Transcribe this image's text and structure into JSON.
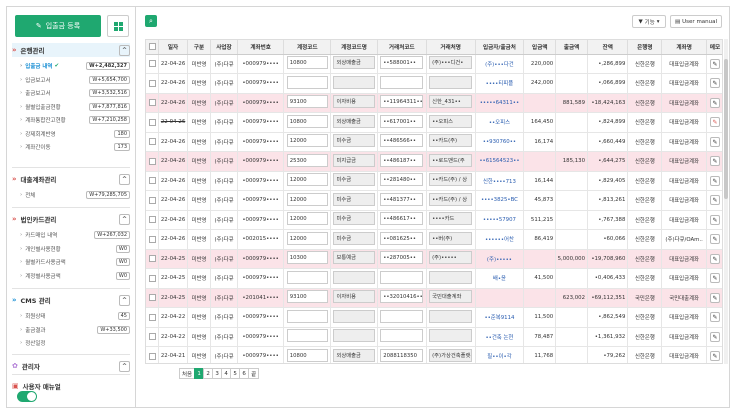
{
  "sidebar": {
    "register_label": "입출금 등록",
    "sections": [
      {
        "title": "은행관리",
        "items": [
          {
            "label": "입출금 내역",
            "badge": "W+2,482,327",
            "current": true
          },
          {
            "label": "입금보고서",
            "badge": "W+5,654,700"
          },
          {
            "label": "출금보고서",
            "badge": "W+3,532,516"
          },
          {
            "label": "월별입출금현황",
            "badge": "W+7,877,816"
          },
          {
            "label": "계좌통합잔고현황",
            "badge": "W+7,210,258"
          },
          {
            "label": "강제회계반영",
            "badge": "180"
          },
          {
            "label": "계좌간이동",
            "badge": "173"
          }
        ]
      },
      {
        "title": "대출계좌관리",
        "items": [
          {
            "label": "전체",
            "badge": "W+79,285,705"
          }
        ]
      },
      {
        "title": "법인카드관리",
        "items": [
          {
            "label": "카드매입 내역",
            "badge": "W+267,032"
          },
          {
            "label": "개인별사용현황",
            "badge": "W0"
          },
          {
            "label": "월별카드사용금액",
            "badge": "W0"
          },
          {
            "label": "계정별사용금액",
            "badge": "W0"
          }
        ]
      },
      {
        "title": "CMS 관리",
        "items": [
          {
            "label": "회원상태",
            "badge": "45"
          },
          {
            "label": "출금결과",
            "badge": "W+33,500"
          },
          {
            "label": "정산일정",
            "badge": ""
          }
        ]
      },
      {
        "title": "관리자",
        "items": []
      },
      {
        "title": "사용자 매뉴얼",
        "items": []
      }
    ]
  },
  "toolbar": {
    "filter_label": "기능",
    "manual_label": "User manual"
  },
  "table": {
    "headers": [
      "일자",
      "구분",
      "사업장",
      "계좌번호",
      "계정코드",
      "계정코드명",
      "거래처코드",
      "거래처명",
      "입금자/출금처",
      "입금액",
      "출금액",
      "잔액",
      "은행명",
      "계좌명",
      "메모"
    ],
    "rows": [
      {
        "date": "22-04-26",
        "gubun": "미반영",
        "biz": "(주)다큐",
        "acct": "•000979••••",
        "code": "10800",
        "codename": "외상매출금",
        "vcode": "••588001••",
        "vname": "(주)•••디건•",
        "payer": "(주)•••다건",
        "in": "220,000",
        "out": "",
        "bal": "•,286,899",
        "bank": "신한은행",
        "acctname": "대표입금계좌",
        "hl": false,
        "strike": false,
        "redEdit": false
      },
      {
        "date": "22-04-26",
        "gubun": "미반영",
        "biz": "(주)다큐",
        "acct": "•000979••••",
        "code": "",
        "codename": "",
        "vcode": "",
        "vname": "",
        "payer": "••••티피플",
        "in": "242,000",
        "out": "",
        "bal": "•,066,899",
        "bank": "신한은행",
        "acctname": "대표입금계좌",
        "hl": false,
        "strike": false,
        "redEdit": false
      },
      {
        "date": "22-04-26",
        "gubun": "미반영",
        "biz": "(주)다큐",
        "acct": "•000979••••",
        "code": "93100",
        "codename": "이자비용",
        "vcode": "••11964311••",
        "vname": "신한_431••",
        "payer": "•••••64311••",
        "in": "",
        "out": "881,589",
        "bal": "•18,424,163",
        "bank": "신한은행",
        "acctname": "대표입금계좌",
        "hl": true,
        "strike": false,
        "redEdit": false
      },
      {
        "date": "22-04-26",
        "gubun": "미반영",
        "biz": "(주)다큐",
        "acct": "•000979••••",
        "code": "10800",
        "codename": "외상매출금",
        "vcode": "••617001••",
        "vname": "••오피스",
        "payer": "••오피스",
        "in": "164,450",
        "out": "",
        "bal": "•,824,899",
        "bank": "신한은행",
        "acctname": "대표입금계좌",
        "hl": false,
        "strike": true,
        "redEdit": true
      },
      {
        "date": "22-04-26",
        "gubun": "미반영",
        "biz": "(주)다큐",
        "acct": "•000979••••",
        "code": "12000",
        "codename": "미수금",
        "vcode": "••486566••",
        "vname": "••카드(주)",
        "payer": "••930760••",
        "in": "16,174",
        "out": "",
        "bal": "•,660,449",
        "bank": "신한은행",
        "acctname": "대표입금계좌",
        "hl": false,
        "strike": false,
        "redEdit": false
      },
      {
        "date": "22-04-26",
        "gubun": "미반영",
        "biz": "(주)다큐",
        "acct": "•000979••••",
        "code": "25300",
        "codename": "미지급금",
        "vcode": "••486187••",
        "vname": "••로드맨드(주",
        "payer": "••61564523••",
        "in": "",
        "out": "185,130",
        "bal": "•,644,275",
        "bank": "신한은행",
        "acctname": "대표입금계좌",
        "hl": true,
        "strike": false,
        "redEdit": false
      },
      {
        "date": "22-04-26",
        "gubun": "미반영",
        "biz": "(주)다큐",
        "acct": "•000979••••",
        "code": "12000",
        "codename": "미수금",
        "vcode": "••281480••",
        "vname": "••카드(주) / 상",
        "payer": "신한••••713",
        "in": "16,144",
        "out": "",
        "bal": "•,829,405",
        "bank": "신한은행",
        "acctname": "대표입금계좌",
        "hl": false,
        "strike": false,
        "redEdit": false
      },
      {
        "date": "22-04-26",
        "gubun": "미반영",
        "biz": "(주)다큐",
        "acct": "•000979••••",
        "code": "12000",
        "codename": "미수금",
        "vcode": "••481377••",
        "vname": "••카드(주) / 상",
        "payer": "••••3825•BC",
        "in": "45,873",
        "out": "",
        "bal": "•,813,261",
        "bank": "신한은행",
        "acctname": "대표입금계좌",
        "hl": false,
        "strike": false,
        "redEdit": false
      },
      {
        "date": "22-04-26",
        "gubun": "미반영",
        "biz": "(주)다큐",
        "acct": "•000979••••",
        "code": "12000",
        "codename": "미수금",
        "vcode": "••486617••",
        "vname": "••••카드",
        "payer": "•••••57907",
        "in": "511,215",
        "out": "",
        "bal": "•,767,388",
        "bank": "신한은행",
        "acctname": "대표입금계좌",
        "hl": false,
        "strike": false,
        "redEdit": false
      },
      {
        "date": "22-04-26",
        "gubun": "미반영",
        "biz": "(주)다큐",
        "acct": "•002015••••",
        "code": "12000",
        "codename": "미수금",
        "vcode": "••081625••",
        "vname": "••버(주)",
        "payer": "••••••어찬",
        "in": "86,419",
        "out": "",
        "bal": "•60,066",
        "bank": "신한은행",
        "acctname": "(주)다큐/OAm..",
        "hl": false,
        "strike": false,
        "redEdit": false
      },
      {
        "date": "22-04-25",
        "gubun": "미반영",
        "biz": "(주)다큐",
        "acct": "•000979••••",
        "code": "10300",
        "codename": "보통예금",
        "vcode": "••287005••",
        "vname": "(주)•••••",
        "payer": "(주)•••••",
        "in": "",
        "out": "5,000,000",
        "bal": "•19,708,960",
        "bank": "신한은행",
        "acctname": "대표입금계좌",
        "hl": true,
        "strike": false,
        "redEdit": false
      },
      {
        "date": "22-04-25",
        "gubun": "미반영",
        "biz": "(주)다큐",
        "acct": "•000979••••",
        "code": "",
        "codename": "",
        "vcode": "",
        "vname": "",
        "payer": "배•윤",
        "in": "41,500",
        "out": "",
        "bal": "•0,406,433",
        "bank": "신한은행",
        "acctname": "대표입금계좌",
        "hl": false,
        "strike": false,
        "redEdit": false
      },
      {
        "date": "22-04-25",
        "gubun": "미반영",
        "biz": "(주)다큐",
        "acct": "•201041••••",
        "code": "93100",
        "codename": "이자비용",
        "vcode": "••32010416••",
        "vname": "국민대출계좌",
        "payer": "",
        "in": "",
        "out": "623,002",
        "bal": "•69,112,351",
        "bank": "국민은행",
        "acctname": "국민대출계좌",
        "hl": true,
        "strike": false,
        "redEdit": false
      },
      {
        "date": "22-04-22",
        "gubun": "미반영",
        "biz": "(주)다큐",
        "acct": "•000979••••",
        "code": "",
        "codename": "",
        "vcode": "",
        "vname": "",
        "payer": "••준복9114",
        "in": "11,500",
        "out": "",
        "bal": "•,862,549",
        "bank": "신한은행",
        "acctname": "대표입금계좌",
        "hl": false,
        "strike": false,
        "redEdit": false
      },
      {
        "date": "22-04-22",
        "gubun": "미반영",
        "biz": "(주)다큐",
        "acct": "•000979••••",
        "code": "",
        "codename": "",
        "vcode": "",
        "vname": "",
        "payer": "••건축 논현",
        "in": "78,487",
        "out": "",
        "bal": "•1,361,932",
        "bank": "신한은행",
        "acctname": "대표입금계좌",
        "hl": false,
        "strike": false,
        "redEdit": false
      },
      {
        "date": "22-04-21",
        "gubun": "미반영",
        "biz": "(주)다큐",
        "acct": "•000979••••",
        "code": "10800",
        "codename": "외상매출금",
        "vcode": "2088118350",
        "vname": "(주)가상건축플랫폼",
        "payer": "필••이•각",
        "in": "11,768",
        "out": "",
        "bal": "•79,262",
        "bank": "신한은행",
        "acctname": "대표입금계좌",
        "hl": false,
        "strike": false,
        "redEdit": false
      }
    ]
  },
  "pager": {
    "first": "처음",
    "pages": [
      "1",
      "2",
      "3",
      "4",
      "5",
      "6"
    ],
    "last": "끝",
    "current": "1"
  }
}
